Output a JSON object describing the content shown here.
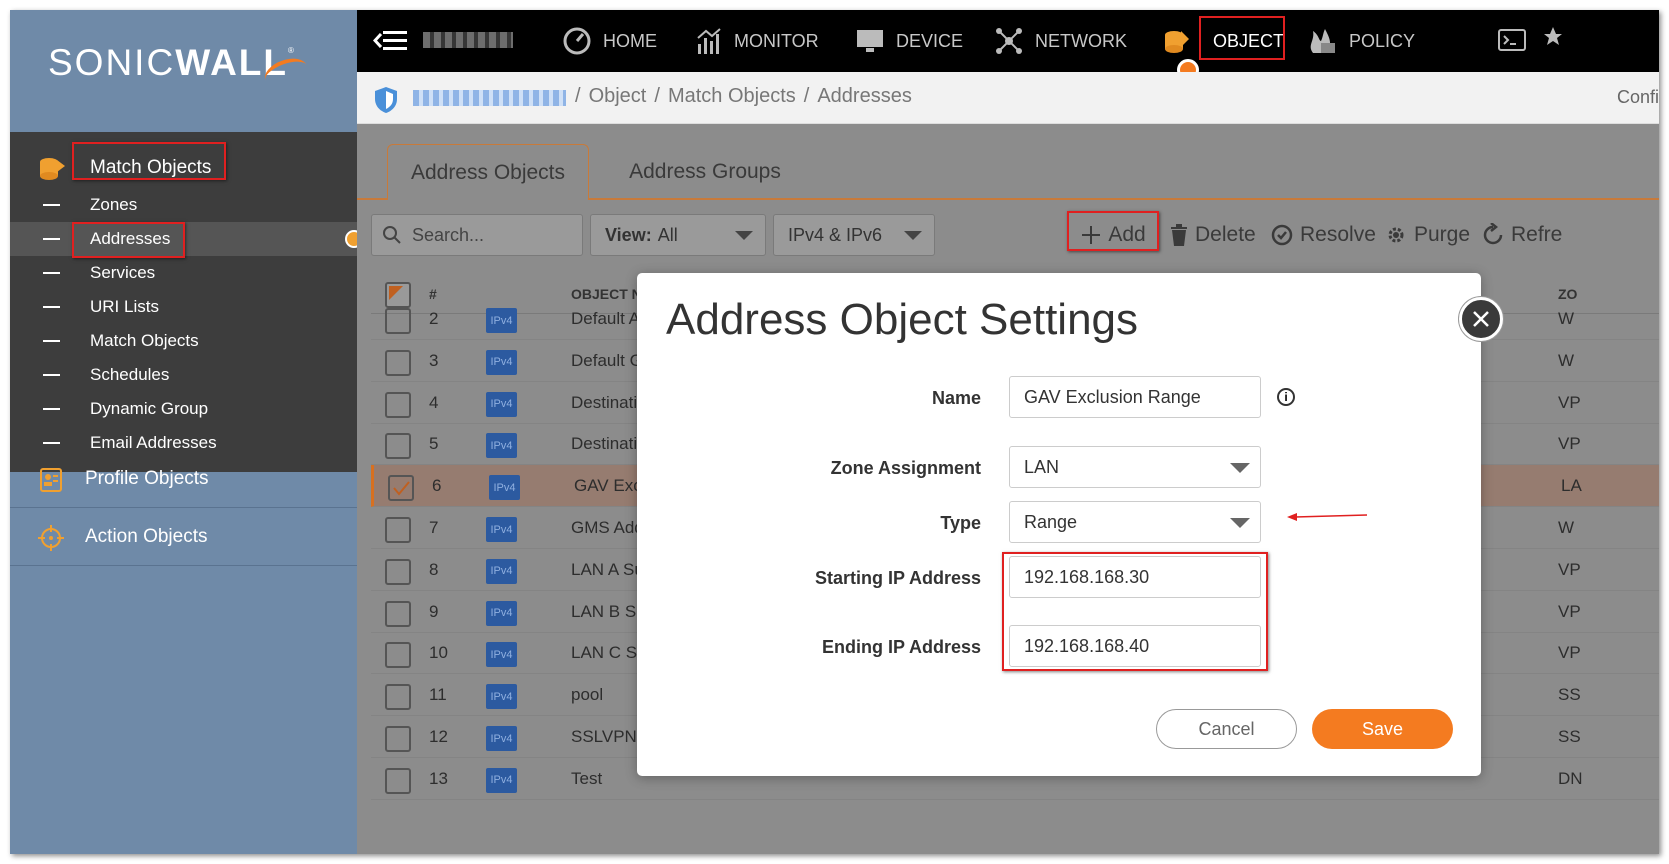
{
  "brand": {
    "name_light": "SONIC",
    "name_bold": "WALL",
    "reg": "®"
  },
  "sidebar": {
    "header": "Match Objects",
    "items": [
      "Zones",
      "Addresses",
      "Services",
      "URI Lists",
      "Match Objects",
      "Schedules",
      "Dynamic Group",
      "Email Addresses"
    ],
    "sections": [
      "Profile Objects",
      "Action Objects"
    ]
  },
  "topnav": [
    "HOME",
    "MONITOR",
    "DEVICE",
    "NETWORK",
    "OBJECT",
    "POLICY"
  ],
  "breadcrumb": {
    "items": [
      "Object",
      "Match Objects",
      "Addresses"
    ],
    "right": "Confi"
  },
  "tabs": [
    "Address Objects",
    "Address Groups"
  ],
  "toolbar": {
    "search_placeholder": "Search...",
    "view_label": "View:",
    "view_value": "All",
    "ipfilter": "IPv4 & IPv6",
    "actions": [
      "Add",
      "Delete",
      "Resolve",
      "Purge",
      "Refre"
    ]
  },
  "grid": {
    "headers": {
      "num": "#",
      "name": "OBJECT NA",
      "zone": "ZO"
    },
    "rows": [
      {
        "num": "2",
        "badge": "IPv4",
        "name": "Default Acti",
        "zone": "W"
      },
      {
        "num": "3",
        "badge": "IPv4",
        "name": "Default Gat",
        "zone": "W"
      },
      {
        "num": "4",
        "badge": "IPv4",
        "name": "Destination",
        "zone": "VP"
      },
      {
        "num": "5",
        "badge": "IPv4",
        "name": "Destination",
        "zone": "VP"
      },
      {
        "num": "6",
        "badge": "IPv4",
        "name": "GAV Exclus",
        "zone": "LA"
      },
      {
        "num": "7",
        "badge": "IPv4",
        "name": "GMS Addre",
        "zone": "W"
      },
      {
        "num": "8",
        "badge": "IPv4",
        "name": "LAN A Subr",
        "zone": "VP"
      },
      {
        "num": "9",
        "badge": "IPv4",
        "name": "LAN B Subr",
        "zone": "VP"
      },
      {
        "num": "10",
        "badge": "IPv4",
        "name": "LAN C Subr",
        "zone": "VP"
      },
      {
        "num": "11",
        "badge": "IPv4",
        "name": "pool",
        "zone": "SS"
      },
      {
        "num": "12",
        "badge": "IPv4",
        "name": "SSLVPN-PC",
        "zone": "SS"
      },
      {
        "num": "13",
        "badge": "IPv4",
        "name": "Test",
        "zone": "DN"
      }
    ]
  },
  "modal": {
    "title": "Address Object Settings",
    "fields": {
      "name": {
        "label": "Name",
        "value": "GAV Exclusion Range"
      },
      "zone": {
        "label": "Zone Assignment",
        "value": "LAN"
      },
      "type": {
        "label": "Type",
        "value": "Range"
      },
      "start": {
        "label": "Starting IP Address",
        "value": "192.168.168.30"
      },
      "end": {
        "label": "Ending IP Address",
        "value": "192.168.168.40"
      }
    },
    "cancel": "Cancel",
    "save": "Save",
    "info": "i"
  }
}
